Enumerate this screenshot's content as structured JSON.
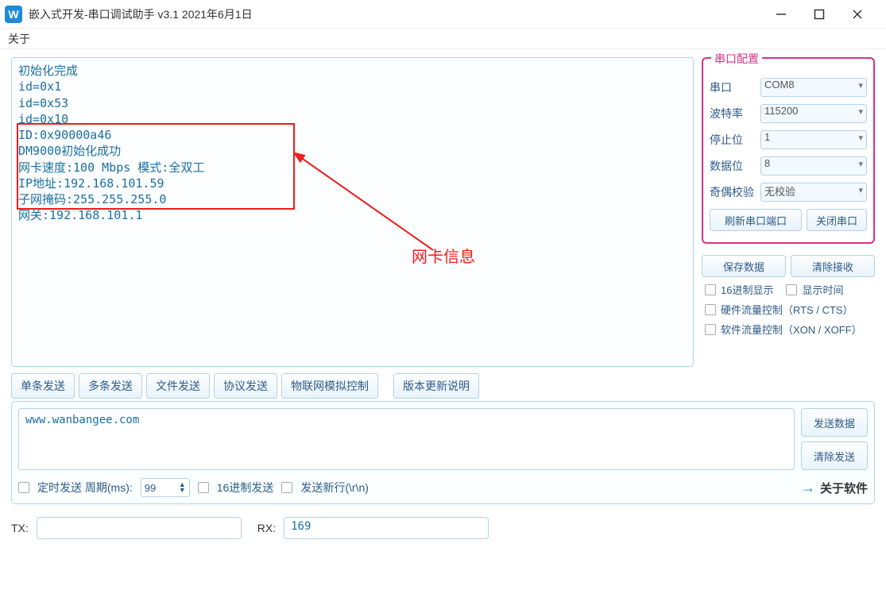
{
  "window": {
    "icon_letter": "W",
    "title": "嵌入式开发-串口调试助手 v3.1 2021年6月1日"
  },
  "menu": {
    "about": "关于"
  },
  "terminal": {
    "lines": [
      "初始化完成",
      "id=0x1",
      "id=0x53",
      "id=0x10",
      "ID:0x90000a46",
      "DM9000初始化成功",
      "网卡速度:100 Mbps  模式:全双工",
      "IP地址:192.168.101.59",
      "子网掩码:255.255.255.0",
      "网关:192.168.101.1"
    ]
  },
  "annotation": {
    "label": "网卡信息"
  },
  "config": {
    "legend": "串口配置",
    "port_label": "串口",
    "port_value": "COM8",
    "baud_label": "波特率",
    "baud_value": "115200",
    "stop_label": "停止位",
    "stop_value": "1",
    "data_label": "数据位",
    "data_value": "8",
    "parity_label": "奇偶校验",
    "parity_value": "无校验",
    "refresh_btn": "刷新串口端口",
    "close_btn": "关闭串口"
  },
  "actions": {
    "save_data": "保存数据",
    "clear_recv": "清除接收",
    "hex_display": "16进制显示",
    "show_time": "显示时间",
    "hw_flow": "硬件流量控制（RTS / CTS）",
    "sw_flow": "软件流量控制（XON / XOFF）"
  },
  "tabs": {
    "single": "单条发送",
    "multi": "多条发送",
    "file": "文件发送",
    "proto": "协议发送",
    "iot": "物联网模拟控制",
    "update": "版本更新说明"
  },
  "send": {
    "text": "www.wanbangee.com",
    "send_btn": "发送数据",
    "clear_btn": "清除发送",
    "timer_label": "定时发送 周期(ms):",
    "timer_value": "99",
    "hex_send": "16进制发送",
    "newline": "发送新行(\\r\\n)",
    "about_sw": "关于软件"
  },
  "status": {
    "tx_label": "TX:",
    "tx_value": "",
    "rx_label": "RX:",
    "rx_value": "169"
  }
}
